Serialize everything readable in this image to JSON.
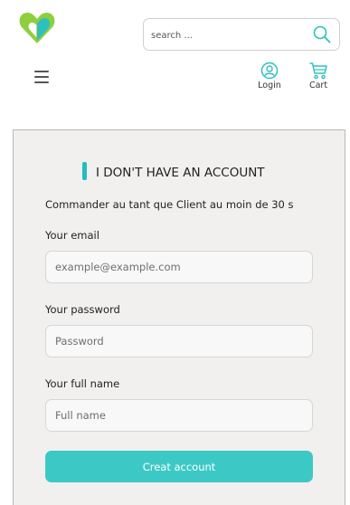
{
  "header": {
    "logo_icon": "heart-logo-icon",
    "search": {
      "placeholder": "search ...",
      "value": "",
      "icon": "search-icon"
    },
    "menu_icon": "hamburger-menu-icon",
    "nav": {
      "login": {
        "label": "Login",
        "icon": "user-circle-icon"
      },
      "cart": {
        "label": "Cart",
        "icon": "cart-icon"
      }
    }
  },
  "form": {
    "heading": "I DON'T HAVE AN ACCOUNT",
    "subtitle": "Commander au tant que Client au moin de 30 s",
    "fields": [
      {
        "label": "Your email",
        "placeholder": "example@example.com",
        "value": ""
      },
      {
        "label": "Your password",
        "placeholder": "Password",
        "value": ""
      },
      {
        "label": "Your full name",
        "placeholder": "Full name",
        "value": ""
      }
    ],
    "submit_label": "Creat account"
  },
  "colors": {
    "accent": "#21bdc0",
    "button": "#3cc9c6",
    "logo_green": "#8ecf3e",
    "logo_teal": "#2fbfbf",
    "panel_bg": "#f1f0ee"
  }
}
